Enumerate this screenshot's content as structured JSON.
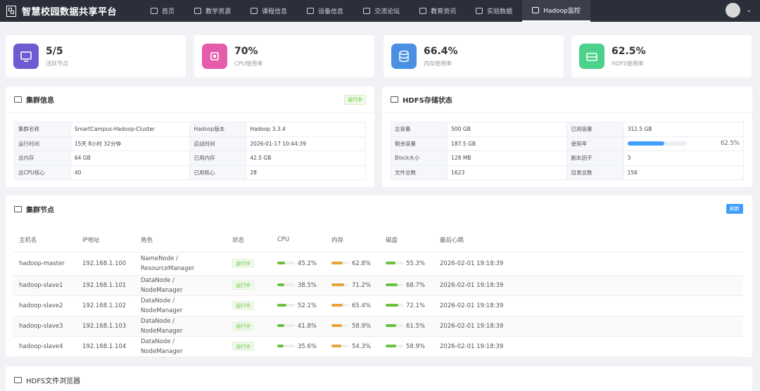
{
  "app_title": "智慧校园数据共享平台",
  "nav": [
    {
      "label": "首页",
      "icon": "home-icon"
    },
    {
      "label": "教学资源",
      "icon": "folder-icon"
    },
    {
      "label": "课程信息",
      "icon": "book-icon"
    },
    {
      "label": "设备信息",
      "icon": "monitor-icon"
    },
    {
      "label": "交流论坛",
      "icon": "chat-icon"
    },
    {
      "label": "教育资讯",
      "icon": "document-icon"
    },
    {
      "label": "实验数据",
      "icon": "chart-icon"
    },
    {
      "label": "Hadoop监控",
      "icon": "gear-icon",
      "active": true
    }
  ],
  "stats": [
    {
      "value": "5/5",
      "label": "活跃节点",
      "icon": "monitor-icon",
      "color": "#6c5ccf"
    },
    {
      "value": "70%",
      "label": "CPU使用率",
      "icon": "cpu-icon",
      "color": "#e55cab"
    },
    {
      "value": "66.4%",
      "label": "内存使用率",
      "icon": "database-icon",
      "color": "#4a90e2"
    },
    {
      "value": "62.5%",
      "label": "HDFS使用率",
      "icon": "storage-icon",
      "color": "#4cd28a"
    }
  ],
  "cluster": {
    "title": "集群信息",
    "status": "运行中",
    "rows": [
      [
        "集群名称",
        "SmartCampus-Hadoop-Cluster",
        "Hadoop版本",
        "Hadoop 3.3.4"
      ],
      [
        "运行时间",
        "15天 8小时 32分钟",
        "启动时间",
        "2026-01-17 10:44:39"
      ],
      [
        "总内存",
        "64 GB",
        "已用内存",
        "42.5 GB"
      ],
      [
        "总CPU核心",
        "40",
        "已用核心",
        "28"
      ]
    ]
  },
  "hdfs": {
    "title": "HDFS存储状态",
    "rows": [
      [
        "总容量",
        "500 GB",
        "已用容量",
        "312.5 GB"
      ],
      [
        "剩余容量",
        "187.5 GB",
        "使用率",
        ""
      ],
      [
        "Block大小",
        "128 MB",
        "副本因子",
        "3"
      ],
      [
        "文件总数",
        "1623",
        "目录总数",
        "156"
      ]
    ],
    "usage_percent": 62.5,
    "usage_text": "62.5%"
  },
  "nodes": {
    "title": "集群节点",
    "refresh_label": "刷新",
    "headers": [
      "主机名",
      "IP地址",
      "角色",
      "状态",
      "CPU",
      "内存",
      "磁盘",
      "最后心跳"
    ],
    "rows": [
      {
        "host": "hadoop-master",
        "ip": "192.168.1.100",
        "role": "NameNode / ResourceManager",
        "status": "运行中",
        "cpu": 45.2,
        "cpu_t": "45.2%",
        "mem": 62.8,
        "mem_t": "62.8%",
        "disk": 55.3,
        "disk_t": "55.3%",
        "hb": "2026-02-01 19:18:39"
      },
      {
        "host": "hadoop-slave1",
        "ip": "192.168.1.101",
        "role": "DataNode / NodeManager",
        "status": "运行中",
        "cpu": 38.5,
        "cpu_t": "38.5%",
        "mem": 71.2,
        "mem_t": "71.2%",
        "disk": 68.7,
        "disk_t": "68.7%",
        "hb": "2026-02-01 19:18:39"
      },
      {
        "host": "hadoop-slave2",
        "ip": "192.168.1.102",
        "role": "DataNode / NodeManager",
        "status": "运行中",
        "cpu": 52.1,
        "cpu_t": "52.1%",
        "mem": 65.4,
        "mem_t": "65.4%",
        "disk": 72.1,
        "disk_t": "72.1%",
        "hb": "2026-02-01 19:18:39"
      },
      {
        "host": "hadoop-slave3",
        "ip": "192.168.1.103",
        "role": "DataNode / NodeManager",
        "status": "运行中",
        "cpu": 41.8,
        "cpu_t": "41.8%",
        "mem": 58.9,
        "mem_t": "58.9%",
        "disk": 61.5,
        "disk_t": "61.5%",
        "hb": "2026-02-01 19:18:39"
      },
      {
        "host": "hadoop-slave4",
        "ip": "192.168.1.104",
        "role": "DataNode / NodeManager",
        "status": "运行中",
        "cpu": 35.6,
        "cpu_t": "35.6%",
        "mem": 54.3,
        "mem_t": "54.3%",
        "disk": 58.9,
        "disk_t": "58.9%",
        "hb": "2026-02-01 19:18:39"
      }
    ],
    "colors": {
      "cpu": "#67c23a",
      "mem": "#e6a23c",
      "disk": "#67c23a"
    }
  },
  "browser": {
    "title": "HDFS文件浏览器"
  }
}
